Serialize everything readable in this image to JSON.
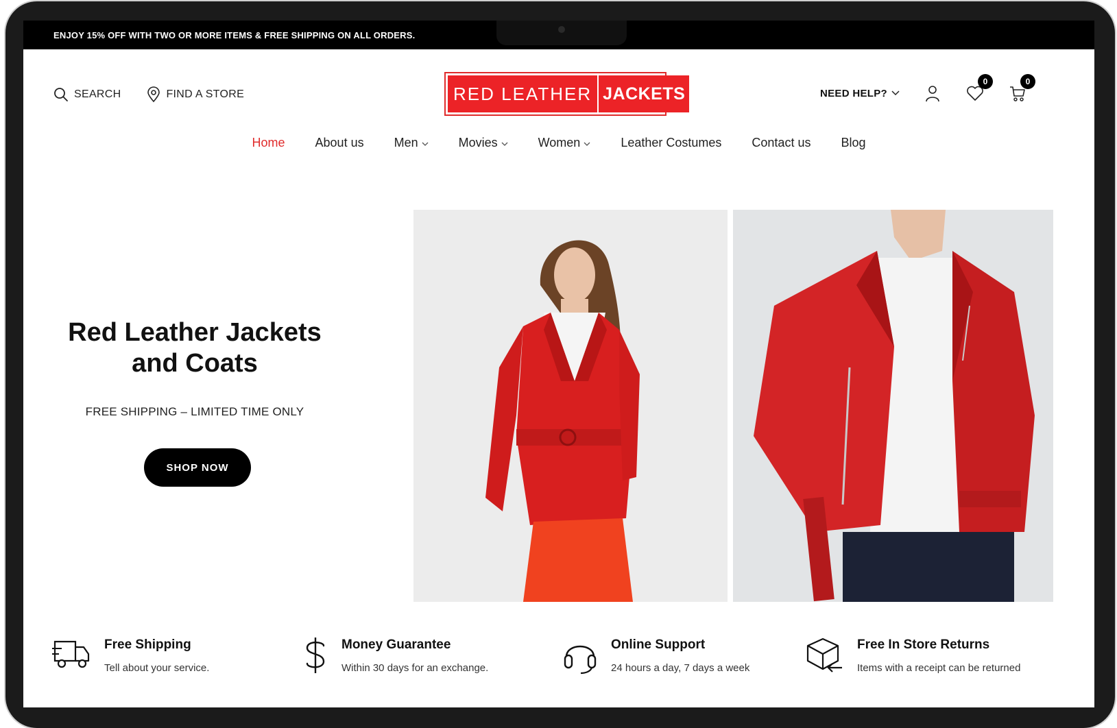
{
  "announcement": "ENJOY 15% OFF WITH TWO OR MORE ITEMS & FREE SHIPPING ON ALL ORDERS.",
  "header": {
    "search_label": "SEARCH",
    "store_label": "FIND A STORE",
    "logo_part1": "RED LEATHER",
    "logo_part2": "JACKETS",
    "help_label": "NEED HELP?",
    "wishlist_count": "0",
    "cart_count": "0"
  },
  "nav": {
    "items": [
      {
        "label": "Home"
      },
      {
        "label": "About us"
      },
      {
        "label": "Men"
      },
      {
        "label": "Movies"
      },
      {
        "label": "Women"
      },
      {
        "label": "Leather Costumes"
      },
      {
        "label": "Contact us"
      },
      {
        "label": "Blog"
      }
    ]
  },
  "hero": {
    "title_line1": "Red Leather Jackets",
    "title_line2": "and Coats",
    "subtitle": "FREE SHIPPING – LIMITED TIME ONLY",
    "button": "SHOP NOW"
  },
  "features": [
    {
      "title": "Free Shipping",
      "text": "Tell about your service.",
      "icon": "truck-icon"
    },
    {
      "title": "Money Guarantee",
      "text": "Within 30 days for an exchange.",
      "icon": "dollar-icon"
    },
    {
      "title": "Online Support",
      "text": "24 hours a day, 7 days a week",
      "icon": "headset-icon"
    },
    {
      "title": "Free In Store Returns",
      "text": "Items with a receipt can be returned",
      "icon": "return-box-icon"
    }
  ],
  "colors": {
    "brand_red": "#ec2327",
    "nav_active": "#e02b2b",
    "bar_black": "#000000"
  }
}
